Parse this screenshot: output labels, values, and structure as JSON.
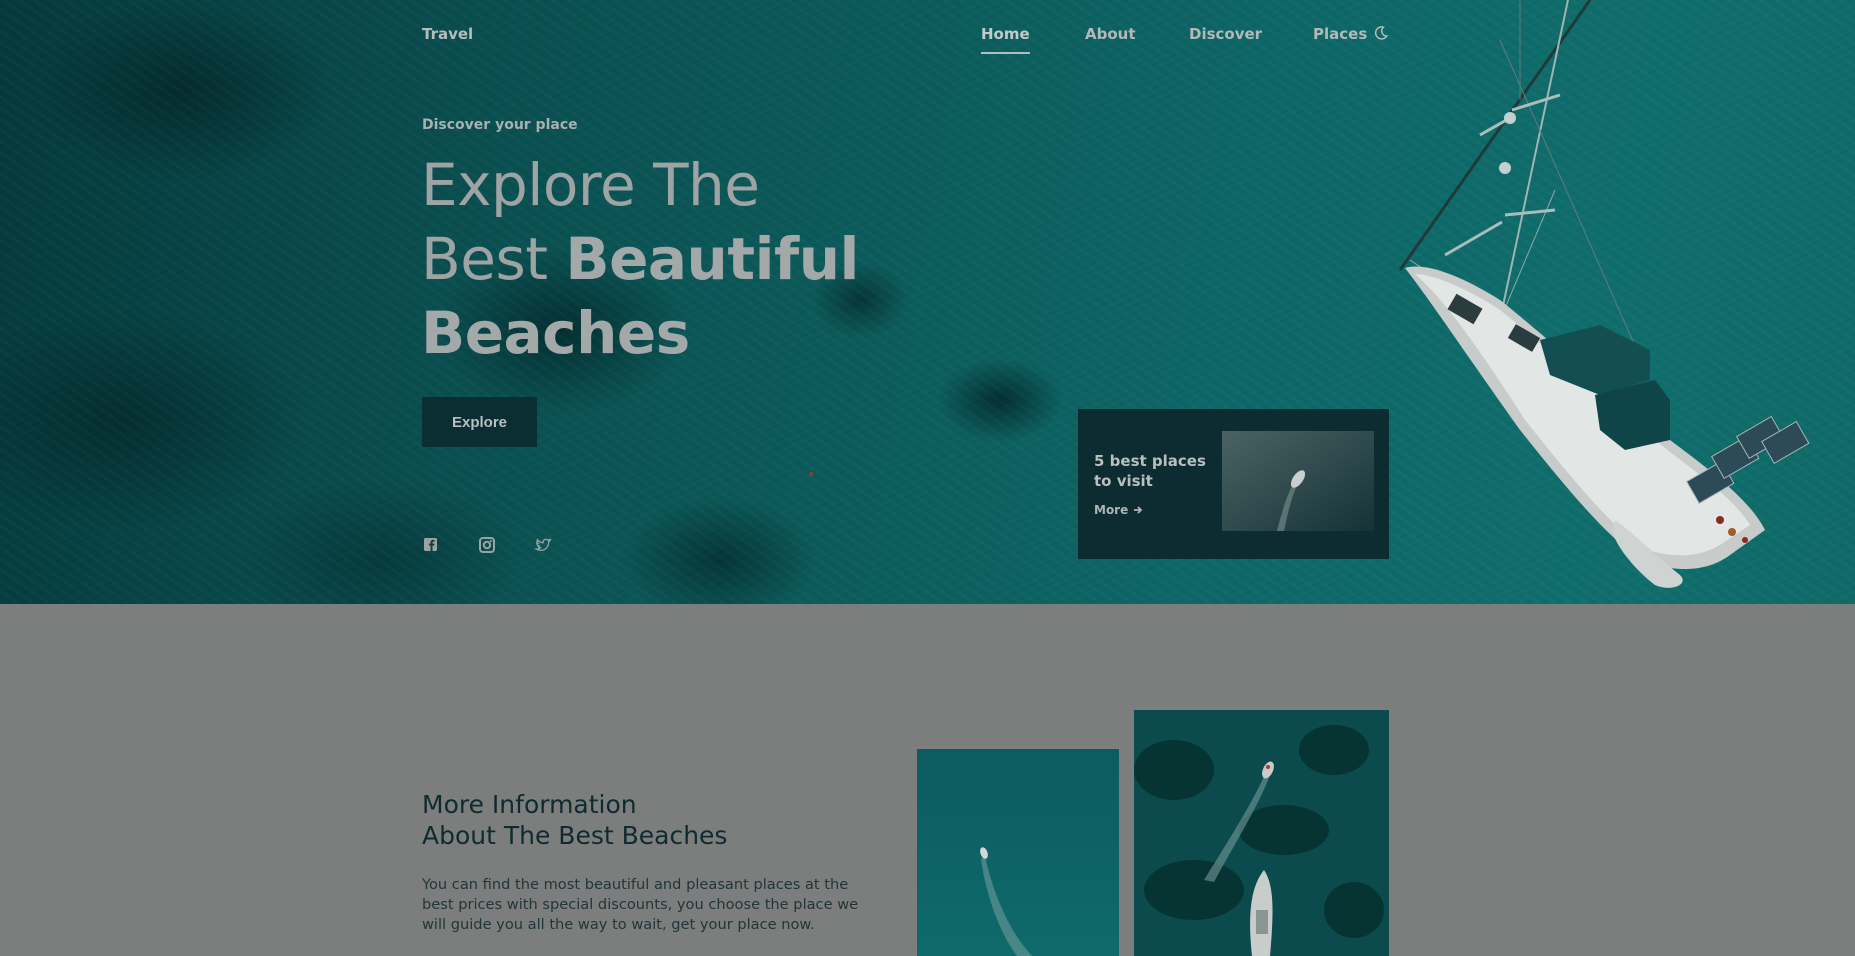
{
  "brand": {
    "logo": "Travel"
  },
  "nav": {
    "items": [
      {
        "label": "Home",
        "active": true
      },
      {
        "label": "About",
        "active": false
      },
      {
        "label": "Discover",
        "active": false
      },
      {
        "label": "Places",
        "active": false
      }
    ],
    "theme_toggle_icon": "moon-icon"
  },
  "hero": {
    "eyebrow": "Discover your place",
    "headline_line1": "Explore The",
    "headline_line2_light": "Best ",
    "headline_line2_bold": "Beautiful",
    "headline_line3_bold": "Beaches",
    "cta_label": "Explore",
    "social_icons": [
      "facebook-icon",
      "instagram-icon",
      "twitter-icon"
    ]
  },
  "place_card": {
    "title": "5 best places to visit",
    "more_label": "More",
    "more_icon": "arrow-right-icon"
  },
  "info": {
    "title_line1": "More Information",
    "title_line2": "About The Best Beaches",
    "text": "You can find the most beautiful and pleasant places at the best prices with special discounts, you choose the place we will guide you all the way to wait, get your place now."
  },
  "colors": {
    "overlay": "#7c7e7e",
    "dark_teal": "#0c2c31",
    "sea": "#0e6666"
  }
}
